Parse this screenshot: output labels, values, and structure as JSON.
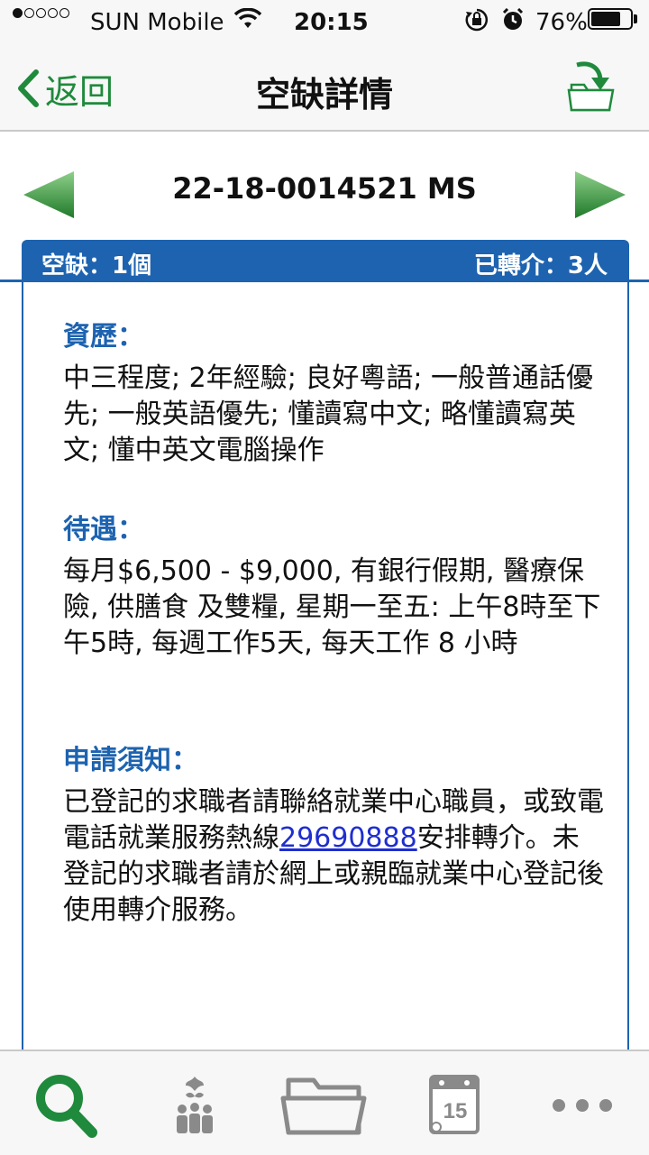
{
  "status_bar": {
    "carrier": "SUN Mobile",
    "time": "20:15",
    "battery": "76%",
    "battery_level": 0.76,
    "signal_bars_filled": 1,
    "signal_bars_total": 5
  },
  "nav": {
    "back_label": "返回",
    "title": "空缺詳情"
  },
  "vacancy": {
    "id": "22-18-0014521 MS",
    "vacancies": "空缺：1個",
    "referred": "已轉介：3人"
  },
  "sections": {
    "qualifications": {
      "heading": "資歷：",
      "body": "中三程度; 2年經驗; 良好粵語; 一般普通話優先; 一般英語優先; 懂讀寫中文; 略懂讀寫英文; 懂中英文電腦操作"
    },
    "benefits": {
      "heading": "待遇：",
      "body": "每月$6,500 - $9,000, 有銀行假期, 醫療保險, 供膳食 及雙糧, 星期一至五: 上午8時至下午5時, 每週工作5天, 每天工作 8 小時"
    },
    "application": {
      "heading": "申請須知：",
      "body_before": "已登記的求職者請聯絡就業中心職員，或致電電話就業服務熱線",
      "phone": "29690888",
      "body_after": "安排轉介。未登記的求職者請於網上或親臨就業中心登記後使用轉介服務。"
    }
  },
  "tabs": [
    {
      "icon": "search-icon"
    },
    {
      "icon": "people-icon"
    },
    {
      "icon": "folder-icon"
    },
    {
      "icon": "calendar-icon",
      "label": "15"
    },
    {
      "icon": "more-icon"
    }
  ],
  "colors": {
    "accent_green": "#1f8a3c",
    "accent_blue": "#1d63b0",
    "link_blue": "#1f2ecf"
  }
}
